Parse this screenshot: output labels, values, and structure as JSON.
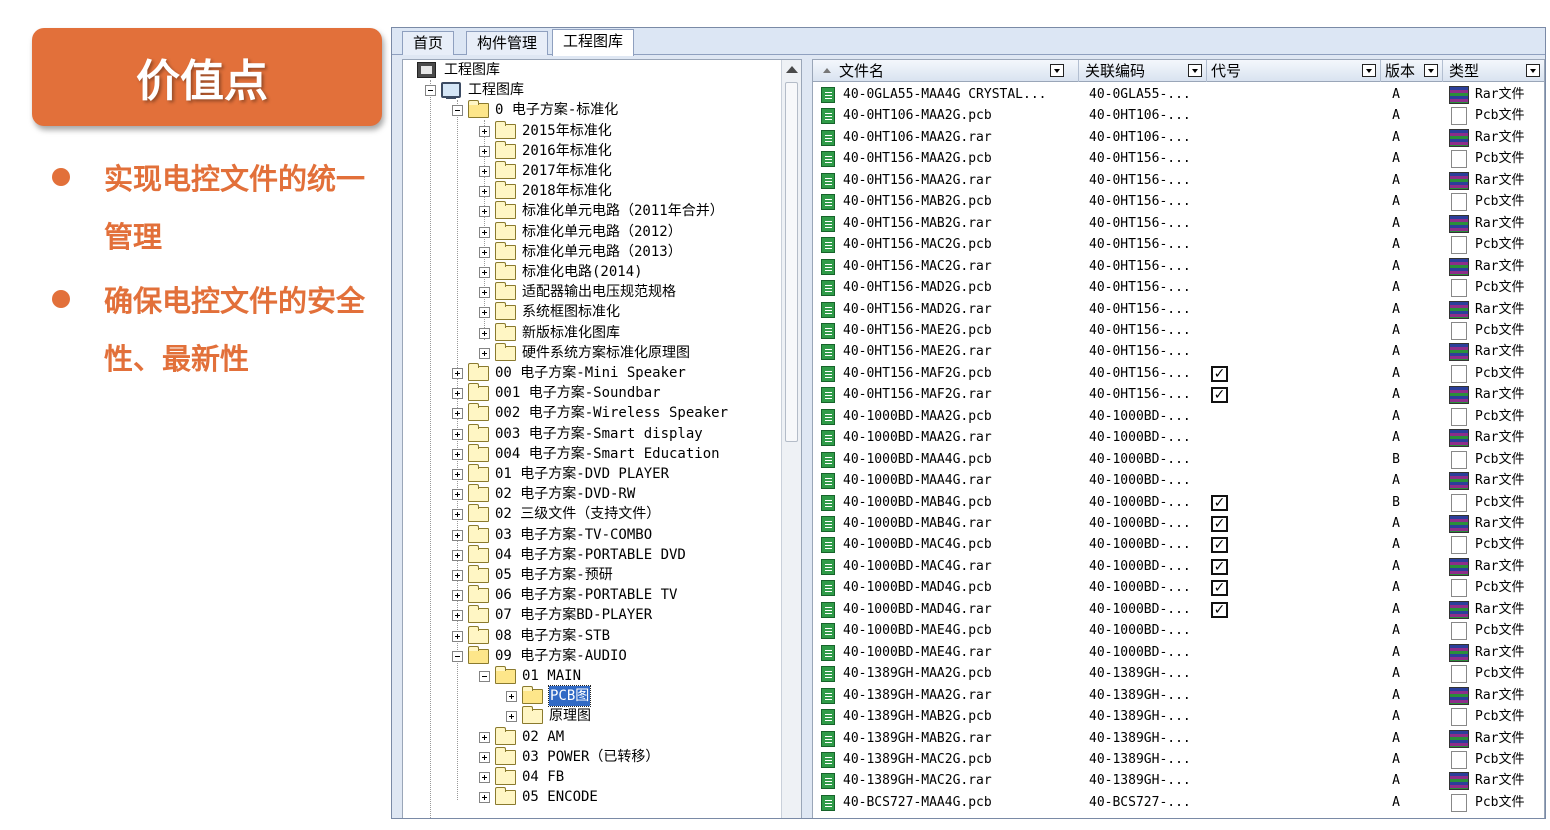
{
  "badge": {
    "title": "价值点"
  },
  "points": [
    {
      "text": "实现电控文件的统一管理"
    },
    {
      "text": "确保电控文件的安全性、最新性"
    }
  ],
  "colors": {
    "accent": "#e2703a",
    "selection": "#316ac5"
  },
  "tabs": [
    {
      "label": "首页"
    },
    {
      "label": "构件管理"
    },
    {
      "label": "工程图库",
      "active": true
    }
  ],
  "tree": {
    "nodes": [
      {
        "label": "工程图库",
        "icon": "root-icon",
        "level": 0
      },
      {
        "label": "工程图库",
        "icon": "computer-icon",
        "level": 1,
        "exp": "minus"
      },
      {
        "label": "0 电子方案-标准化",
        "icon": "folder-icon",
        "level": 2,
        "exp": "minus",
        "open": true
      },
      {
        "label": "2015年标准化",
        "icon": "folder-icon",
        "level": 3,
        "exp": "plus"
      },
      {
        "label": "2016年标准化",
        "icon": "folder-icon",
        "level": 3,
        "exp": "plus"
      },
      {
        "label": "2017年标准化",
        "icon": "folder-icon",
        "level": 3,
        "exp": "plus"
      },
      {
        "label": "2018年标准化",
        "icon": "folder-icon",
        "level": 3,
        "exp": "plus"
      },
      {
        "label": "标准化单元电路（2011年合并）",
        "icon": "folder-icon",
        "level": 3,
        "exp": "plus"
      },
      {
        "label": "标准化单元电路（2012）",
        "icon": "folder-icon",
        "level": 3,
        "exp": "plus"
      },
      {
        "label": "标准化单元电路（2013）",
        "icon": "folder-icon",
        "level": 3,
        "exp": "plus"
      },
      {
        "label": "标准化电路(2014)",
        "icon": "folder-icon",
        "level": 3,
        "exp": "plus"
      },
      {
        "label": "适配器输出电压规范规格",
        "icon": "folder-icon",
        "level": 3,
        "exp": "plus"
      },
      {
        "label": "系统框图标准化",
        "icon": "folder-icon",
        "level": 3,
        "exp": "plus"
      },
      {
        "label": "新版标准化图库",
        "icon": "folder-icon",
        "level": 3,
        "exp": "plus"
      },
      {
        "label": "硬件系统方案标准化原理图",
        "icon": "folder-icon",
        "level": 3,
        "exp": "plus"
      },
      {
        "label": "00 电子方案-Mini Speaker",
        "icon": "folder-icon",
        "level": 2,
        "exp": "plus"
      },
      {
        "label": "001 电子方案-Soundbar",
        "icon": "folder-icon",
        "level": 2,
        "exp": "plus"
      },
      {
        "label": "002 电子方案-Wireless Speaker",
        "icon": "folder-icon",
        "level": 2,
        "exp": "plus"
      },
      {
        "label": "003 电子方案-Smart display",
        "icon": "folder-icon",
        "level": 2,
        "exp": "plus"
      },
      {
        "label": "004 电子方案-Smart Education",
        "icon": "folder-icon",
        "level": 2,
        "exp": "plus"
      },
      {
        "label": "01 电子方案-DVD PLAYER",
        "icon": "folder-icon",
        "level": 2,
        "exp": "plus"
      },
      {
        "label": "02 电子方案-DVD-RW",
        "icon": "folder-icon",
        "level": 2,
        "exp": "plus"
      },
      {
        "label": "02 三级文件（支持文件）",
        "icon": "folder-icon",
        "level": 2,
        "exp": "plus"
      },
      {
        "label": "03 电子方案-TV-COMBO",
        "icon": "folder-icon",
        "level": 2,
        "exp": "plus"
      },
      {
        "label": "04 电子方案-PORTABLE DVD",
        "icon": "folder-icon",
        "level": 2,
        "exp": "plus"
      },
      {
        "label": "05 电子方案-预研",
        "icon": "folder-icon",
        "level": 2,
        "exp": "plus"
      },
      {
        "label": "06 电子方案-PORTABLE TV",
        "icon": "folder-icon",
        "level": 2,
        "exp": "plus"
      },
      {
        "label": "07 电子方案BD-PLAYER",
        "icon": "folder-icon",
        "level": 2,
        "exp": "plus"
      },
      {
        "label": "08 电子方案-STB",
        "icon": "folder-icon",
        "level": 2,
        "exp": "plus"
      },
      {
        "label": "09 电子方案-AUDIO",
        "icon": "folder-icon",
        "level": 2,
        "exp": "minus",
        "open": true
      },
      {
        "label": "01 MAIN",
        "icon": "folder-icon",
        "level": 3,
        "exp": "minus",
        "open": true
      },
      {
        "label": "PCB图",
        "icon": "folder-icon",
        "level": 4,
        "exp": "plus",
        "open": true,
        "selected": true
      },
      {
        "label": "原理图",
        "icon": "folder-icon",
        "level": 4,
        "exp": "plus"
      },
      {
        "label": "02 AM",
        "icon": "folder-icon",
        "level": 3,
        "exp": "plus"
      },
      {
        "label": "03 POWER（已转移）",
        "icon": "folder-icon",
        "level": 3,
        "exp": "plus"
      },
      {
        "label": "04 FB",
        "icon": "folder-icon",
        "level": 3,
        "exp": "plus"
      },
      {
        "label": "05 ENCODE",
        "icon": "folder-icon",
        "level": 3,
        "exp": "plus"
      }
    ]
  },
  "list": {
    "columns": [
      {
        "label": "文件名"
      },
      {
        "label": "关联编码"
      },
      {
        "label": "代号"
      },
      {
        "label": "版本"
      },
      {
        "label": "类型"
      }
    ],
    "rows": [
      {
        "name": "40-0GLA55-MAA4G CRYSTAL...",
        "code": "40-0GLA55-...",
        "checked": false,
        "version": "A",
        "type": "Rar文件",
        "ticon": "rar"
      },
      {
        "name": "40-0HT106-MAA2G.pcb",
        "code": "40-0HT106-...",
        "checked": false,
        "version": "A",
        "type": "Pcb文件",
        "ticon": "pcb"
      },
      {
        "name": "40-0HT106-MAA2G.rar",
        "code": "40-0HT106-...",
        "checked": false,
        "version": "A",
        "type": "Rar文件",
        "ticon": "rar"
      },
      {
        "name": "40-0HT156-MAA2G.pcb",
        "code": "40-0HT156-...",
        "checked": false,
        "version": "A",
        "type": "Pcb文件",
        "ticon": "pcb"
      },
      {
        "name": "40-0HT156-MAA2G.rar",
        "code": "40-0HT156-...",
        "checked": false,
        "version": "A",
        "type": "Rar文件",
        "ticon": "rar"
      },
      {
        "name": "40-0HT156-MAB2G.pcb",
        "code": "40-0HT156-...",
        "checked": false,
        "version": "A",
        "type": "Pcb文件",
        "ticon": "pcb"
      },
      {
        "name": "40-0HT156-MAB2G.rar",
        "code": "40-0HT156-...",
        "checked": false,
        "version": "A",
        "type": "Rar文件",
        "ticon": "rar"
      },
      {
        "name": "40-0HT156-MAC2G.pcb",
        "code": "40-0HT156-...",
        "checked": false,
        "version": "A",
        "type": "Pcb文件",
        "ticon": "pcb"
      },
      {
        "name": "40-0HT156-MAC2G.rar",
        "code": "40-0HT156-...",
        "checked": false,
        "version": "A",
        "type": "Rar文件",
        "ticon": "rar"
      },
      {
        "name": "40-0HT156-MAD2G.pcb",
        "code": "40-0HT156-...",
        "checked": false,
        "version": "A",
        "type": "Pcb文件",
        "ticon": "pcb"
      },
      {
        "name": "40-0HT156-MAD2G.rar",
        "code": "40-0HT156-...",
        "checked": false,
        "version": "A",
        "type": "Rar文件",
        "ticon": "rar"
      },
      {
        "name": "40-0HT156-MAE2G.pcb",
        "code": "40-0HT156-...",
        "checked": false,
        "version": "A",
        "type": "Pcb文件",
        "ticon": "pcb"
      },
      {
        "name": "40-0HT156-MAE2G.rar",
        "code": "40-0HT156-...",
        "checked": false,
        "version": "A",
        "type": "Rar文件",
        "ticon": "rar"
      },
      {
        "name": "40-0HT156-MAF2G.pcb",
        "code": "40-0HT156-...",
        "checked": true,
        "version": "A",
        "type": "Pcb文件",
        "ticon": "pcb"
      },
      {
        "name": "40-0HT156-MAF2G.rar",
        "code": "40-0HT156-...",
        "checked": true,
        "version": "A",
        "type": "Rar文件",
        "ticon": "rar"
      },
      {
        "name": "40-1000BD-MAA2G.pcb",
        "code": "40-1000BD-...",
        "checked": false,
        "version": "A",
        "type": "Pcb文件",
        "ticon": "pcb"
      },
      {
        "name": "40-1000BD-MAA2G.rar",
        "code": "40-1000BD-...",
        "checked": false,
        "version": "A",
        "type": "Rar文件",
        "ticon": "rar"
      },
      {
        "name": "40-1000BD-MAA4G.pcb",
        "code": "40-1000BD-...",
        "checked": false,
        "version": "B",
        "type": "Pcb文件",
        "ticon": "pcb"
      },
      {
        "name": "40-1000BD-MAA4G.rar",
        "code": "40-1000BD-...",
        "checked": false,
        "version": "A",
        "type": "Rar文件",
        "ticon": "rar"
      },
      {
        "name": "40-1000BD-MAB4G.pcb",
        "code": "40-1000BD-...",
        "checked": true,
        "version": "B",
        "type": "Pcb文件",
        "ticon": "pcb"
      },
      {
        "name": "40-1000BD-MAB4G.rar",
        "code": "40-1000BD-...",
        "checked": true,
        "version": "A",
        "type": "Rar文件",
        "ticon": "rar"
      },
      {
        "name": "40-1000BD-MAC4G.pcb",
        "code": "40-1000BD-...",
        "checked": true,
        "version": "A",
        "type": "Pcb文件",
        "ticon": "pcb"
      },
      {
        "name": "40-1000BD-MAC4G.rar",
        "code": "40-1000BD-...",
        "checked": true,
        "version": "A",
        "type": "Rar文件",
        "ticon": "rar"
      },
      {
        "name": "40-1000BD-MAD4G.pcb",
        "code": "40-1000BD-...",
        "checked": true,
        "version": "A",
        "type": "Pcb文件",
        "ticon": "pcb"
      },
      {
        "name": "40-1000BD-MAD4G.rar",
        "code": "40-1000BD-...",
        "checked": true,
        "version": "A",
        "type": "Rar文件",
        "ticon": "rar"
      },
      {
        "name": "40-1000BD-MAE4G.pcb",
        "code": "40-1000BD-...",
        "checked": false,
        "version": "A",
        "type": "Pcb文件",
        "ticon": "pcb"
      },
      {
        "name": "40-1000BD-MAE4G.rar",
        "code": "40-1000BD-...",
        "checked": false,
        "version": "A",
        "type": "Rar文件",
        "ticon": "rar"
      },
      {
        "name": "40-1389GH-MAA2G.pcb",
        "code": "40-1389GH-...",
        "checked": false,
        "version": "A",
        "type": "Pcb文件",
        "ticon": "pcb"
      },
      {
        "name": "40-1389GH-MAA2G.rar",
        "code": "40-1389GH-...",
        "checked": false,
        "version": "A",
        "type": "Rar文件",
        "ticon": "rar"
      },
      {
        "name": "40-1389GH-MAB2G.pcb",
        "code": "40-1389GH-...",
        "checked": false,
        "version": "A",
        "type": "Pcb文件",
        "ticon": "pcb"
      },
      {
        "name": "40-1389GH-MAB2G.rar",
        "code": "40-1389GH-...",
        "checked": false,
        "version": "A",
        "type": "Rar文件",
        "ticon": "rar"
      },
      {
        "name": "40-1389GH-MAC2G.pcb",
        "code": "40-1389GH-...",
        "checked": false,
        "version": "A",
        "type": "Pcb文件",
        "ticon": "pcb"
      },
      {
        "name": "40-1389GH-MAC2G.rar",
        "code": "40-1389GH-...",
        "checked": false,
        "version": "A",
        "type": "Rar文件",
        "ticon": "rar"
      },
      {
        "name": "40-BCS727-MAA4G.pcb",
        "code": "40-BCS727-...",
        "checked": false,
        "version": "A",
        "type": "Pcb文件",
        "ticon": "pcb"
      }
    ]
  }
}
